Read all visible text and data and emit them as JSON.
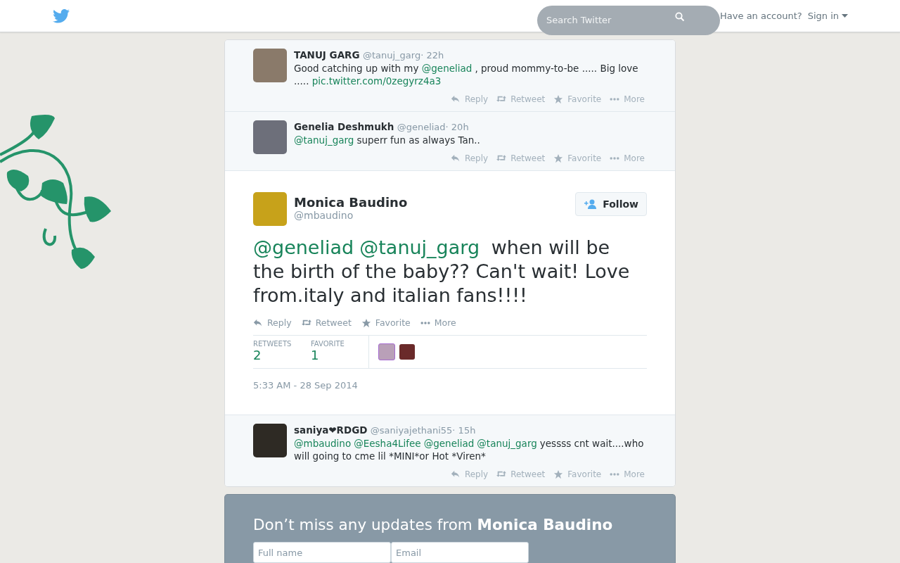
{
  "topbar": {
    "search": {
      "placeholder": "Search Twitter"
    },
    "account_prompt": "Have an account?",
    "sign_in": "Sign in"
  },
  "replies_before": [
    {
      "name": "TANUJ GARG",
      "handle": "@tanuj_garg",
      "time": "· 22h",
      "text": [
        {
          "kind": "text",
          "text": "Good catching up with my "
        },
        {
          "kind": "link",
          "text": "@geneliad"
        },
        {
          "kind": "text",
          "text": ", proud mommy-to-be ..... Big love ..... "
        },
        {
          "kind": "link",
          "text": "pic.twitter.com/0zegyrz4a3"
        }
      ],
      "actions": [
        {
          "kind": "reply",
          "label": "Reply"
        },
        {
          "kind": "retweet",
          "label": "Retweet"
        },
        {
          "kind": "favorite",
          "label": "Favorite"
        },
        {
          "kind": "more",
          "label": "More"
        }
      ]
    },
    {
      "name": "Genelia Deshmukh",
      "handle": "@geneliad",
      "time": "· 20h",
      "text": [
        {
          "kind": "link",
          "text": "@tanuj_garg"
        },
        {
          "kind": "text",
          "text": "superr fun as always Tan.."
        }
      ],
      "actions": [
        {
          "kind": "reply",
          "label": "Reply"
        },
        {
          "kind": "retweet",
          "label": "Retweet"
        },
        {
          "kind": "favorite",
          "label": "Favorite"
        },
        {
          "kind": "more",
          "label": "More"
        }
      ]
    }
  ],
  "main_tweet": {
    "name": "Monica Baudino",
    "handle": "@mbaudino",
    "follow": "Follow",
    "text": [
      {
        "kind": "link",
        "text": "@geneliad"
      },
      {
        "kind": "link",
        "text": "@tanuj_garg"
      },
      {
        "kind": "text",
        "text": " when will be the birth of the baby?? Can't wait! Love from.italy and italian fans!!!!"
      }
    ],
    "actions": [
      {
        "kind": "reply",
        "label": "Reply"
      },
      {
        "kind": "retweet",
        "label": "Retweet"
      },
      {
        "kind": "favorite",
        "label": "Favorite"
      },
      {
        "kind": "more",
        "label": "More"
      }
    ],
    "stats": [
      {
        "label": "RETWEETS",
        "value": "2"
      },
      {
        "label": "FAVORITE",
        "value": "1"
      }
    ],
    "date": "5:33 AM - 28 Sep 2014"
  },
  "replies_after": [
    {
      "name": "saniya❤RDGD",
      "handle": "@saniyajethani55",
      "time": "· 15h",
      "text": [
        {
          "kind": "link",
          "text": "@mbaudino"
        },
        {
          "kind": "link",
          "text": "@Eesha4Lifee"
        },
        {
          "kind": "link",
          "text": "@geneliad"
        },
        {
          "kind": "link",
          "text": "@tanuj_garg"
        },
        {
          "kind": "text",
          "text": "yessss cnt wait....who will going to cme lil *MINI*or Hot *Viren*"
        }
      ],
      "actions": [
        {
          "kind": "reply",
          "label": "Reply"
        },
        {
          "kind": "retweet",
          "label": "Retweet"
        },
        {
          "kind": "favorite",
          "label": "Favorite"
        },
        {
          "kind": "more",
          "label": "More"
        }
      ]
    }
  ],
  "signup": {
    "heading": "Don’t miss any updates from **Monica Baudino**",
    "fields": [
      {
        "placeholder": "Full name"
      },
      {
        "placeholder": "Email"
      }
    ]
  }
}
